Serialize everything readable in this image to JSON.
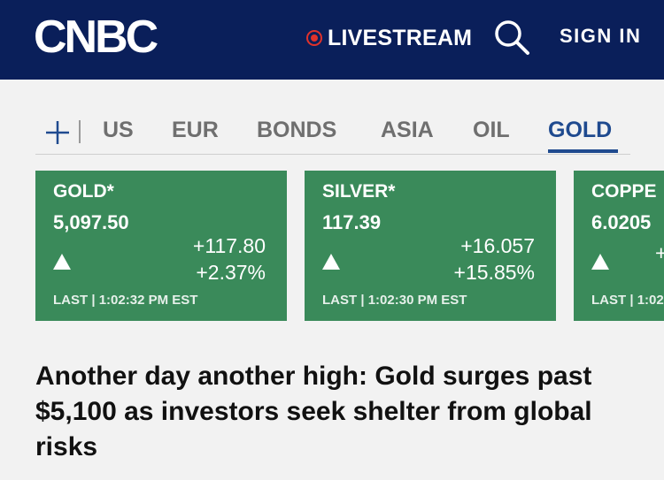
{
  "header": {
    "logo_text": "CNBC",
    "livestream_label": "LIVESTREAM",
    "signin_label": "SIGN IN",
    "accent_live": "#e0322b",
    "background": "#0a1f5a"
  },
  "tabs": {
    "items": [
      {
        "label": "US"
      },
      {
        "label": "EUR"
      },
      {
        "label": "BONDS"
      },
      {
        "label": "ASIA"
      },
      {
        "label": "OIL"
      },
      {
        "label": "GOLD"
      }
    ],
    "active": "GOLD",
    "active_color": "#1f4a8f"
  },
  "quotes": [
    {
      "name": "GOLD*",
      "price": "5,097.50",
      "change": "+117.80",
      "percent": "+2.37%",
      "last_label": "LAST",
      "time": "1:02:32 PM EST",
      "direction": "up"
    },
    {
      "name": "SILVER*",
      "price": "117.39",
      "change": "+16.057",
      "percent": "+15.85%",
      "last_label": "LAST",
      "time": "1:02:30 PM EST",
      "direction": "up"
    },
    {
      "name": "COPPE",
      "price": "6.0205",
      "change": "+",
      "percent": "",
      "last_label": "LAST",
      "time": "1:02",
      "direction": "up"
    }
  ],
  "card_color": "#3a8a5a",
  "headline": "Another day another high: Gold surges past $5,100 as investors seek shelter from global risks"
}
